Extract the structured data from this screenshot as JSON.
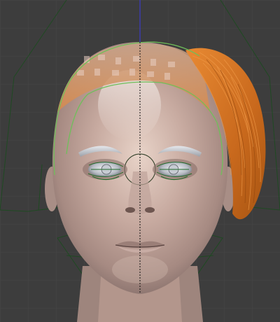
{
  "viewport": {
    "background_color": "#3d3d3d",
    "grid_color": "#474747",
    "axis_color": "#3a3adf",
    "wire_color": "#1a4a1a",
    "selection_color": "#7fc060",
    "skin_base": "#c8aaa0",
    "hair_color": "#d8782a",
    "eye_white": "#cfd3d8"
  },
  "scene": {
    "objects": [
      {
        "name": "head-mesh"
      },
      {
        "name": "hair-strands"
      },
      {
        "name": "left-eye"
      },
      {
        "name": "right-eye"
      },
      {
        "name": "left-eyebrow"
      },
      {
        "name": "right-eyebrow"
      }
    ]
  }
}
